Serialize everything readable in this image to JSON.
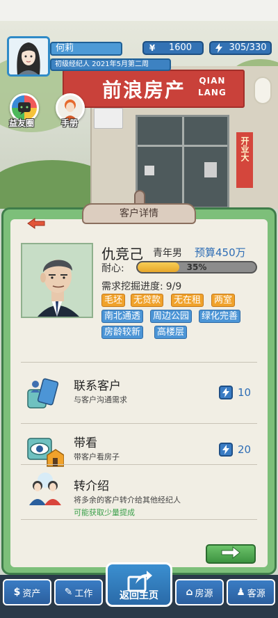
{
  "player": {
    "name": "何莉",
    "title": "初级经纪人 2021年5月第二周",
    "money": "1600",
    "energy": "305/330"
  },
  "icons": {
    "money": "yen-icon",
    "energy": "lightning-icon"
  },
  "side_buttons": {
    "friends_label": "益友圈",
    "handbook_label": "手册"
  },
  "scene": {
    "shop_name": "前浪房产",
    "shop_name_en_1": "QIAN",
    "shop_name_en_2": "LANG",
    "side_banner": "开业大"
  },
  "panel": {
    "title": "客户详情"
  },
  "customer": {
    "name": "仇竞己",
    "type": "青年男",
    "budget": "预算450万",
    "patience_label": "耐心:",
    "patience_text": "35%",
    "patience_value": 0.35,
    "mining_label": "需求挖掘进度:",
    "mining_value": "9/9",
    "tags_row1": [
      "毛坯",
      "无贷款",
      "无在租",
      "两室"
    ],
    "tags_row2": [
      "南北通透",
      "周边公园",
      "绿化完善"
    ],
    "tags_row3": [
      "房龄较新",
      "高楼层"
    ]
  },
  "actions": [
    {
      "title": "联系客户",
      "subtitle": "与客户沟通需求",
      "cost": "10"
    },
    {
      "title": "带看",
      "subtitle": "带客户看房子",
      "cost": "20"
    },
    {
      "title": "转介绍",
      "subtitle": "将多余的客户转介给其他经纪人",
      "hint": "可能获取少量提成"
    }
  ],
  "nav": {
    "assets": "资产",
    "work": "工作",
    "home": "返回主页",
    "listings": "房源",
    "clients": "客源"
  },
  "colors": {
    "panel_green": "#7dbf7a",
    "accent_blue": "#3a7cc4",
    "tag_orange": "#f0a22b",
    "tag_blue": "#4c95d6",
    "sign_red": "#c9413a"
  }
}
